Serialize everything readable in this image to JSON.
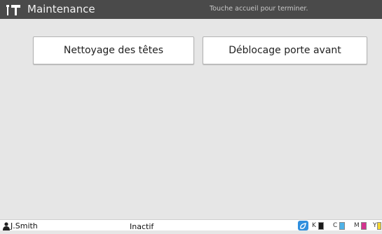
{
  "header": {
    "title": "Maintenance",
    "hint": "Touche accueil pour terminer."
  },
  "buttons": {
    "head_cleaning": "Nettoyage des têtes",
    "front_door_release": "Déblocage porte avant"
  },
  "footer": {
    "user": "J.Smith",
    "status": "Inactif",
    "ink": [
      {
        "label": "K",
        "color": "#1a1a1a"
      },
      {
        "label": "C",
        "color": "#4fb3e8"
      },
      {
        "label": "M",
        "color": "#d4348f"
      },
      {
        "label": "Y",
        "color": "#f3d531"
      }
    ]
  },
  "colors": {
    "header_bg": "#4a4a4a",
    "body_bg": "#e6e6e6"
  },
  "icons": [
    "tools-icon",
    "user-icon",
    "ink-status-icon"
  ]
}
